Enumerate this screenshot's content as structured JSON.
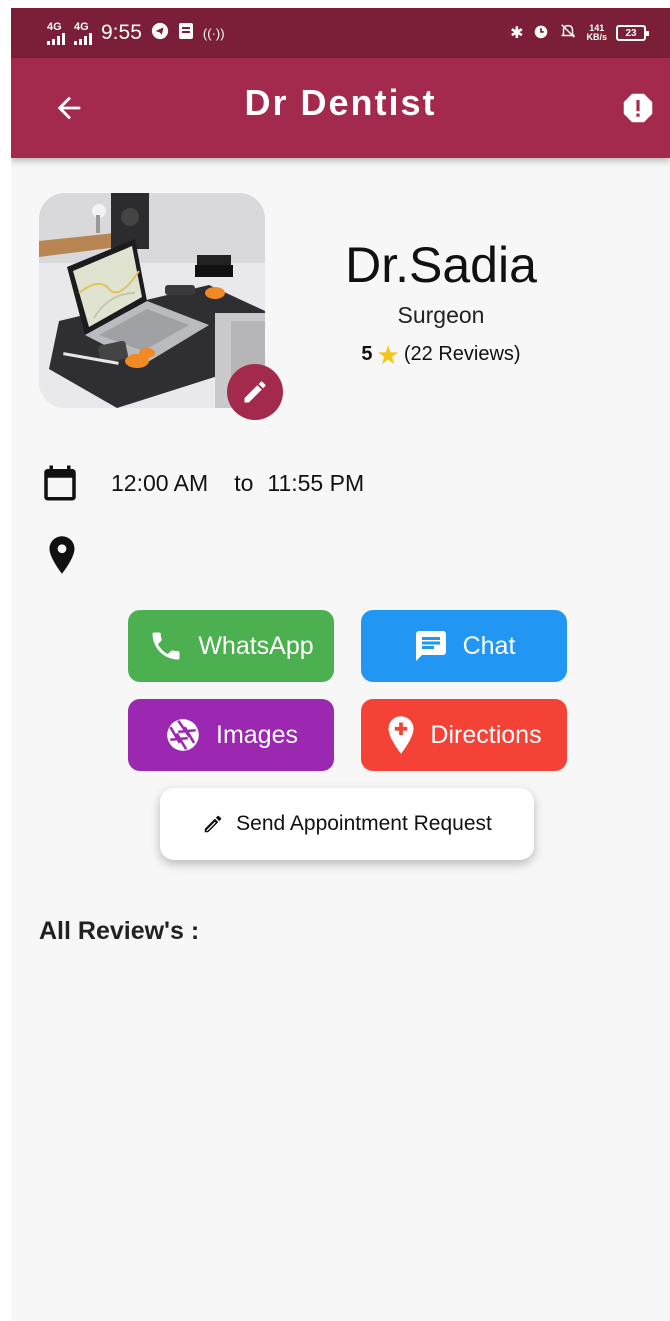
{
  "status_bar": {
    "network_1": "4G",
    "network_2": "4G",
    "time": "9:55",
    "speed_value": "141",
    "speed_unit": "KB/s",
    "battery": "23"
  },
  "app_bar": {
    "title": "Dr Dentist",
    "color": "#a3294d"
  },
  "profile": {
    "name": "Dr.Sadia",
    "specialty": "Surgeon",
    "rating": "5",
    "reviews": "(22 Reviews)"
  },
  "schedule": {
    "start": "12:00 AM",
    "separator": "to",
    "end": "11:55 PM"
  },
  "actions": {
    "whatsapp": "WhatsApp",
    "chat": "Chat",
    "images": "Images",
    "directions": "Directions",
    "appointment": "Send Appointment Request"
  },
  "colors": {
    "whatsapp": "#4caf50",
    "chat": "#2196f3",
    "images": "#9c27b0",
    "directions": "#f44336"
  },
  "reviews_heading": "All Review's :"
}
